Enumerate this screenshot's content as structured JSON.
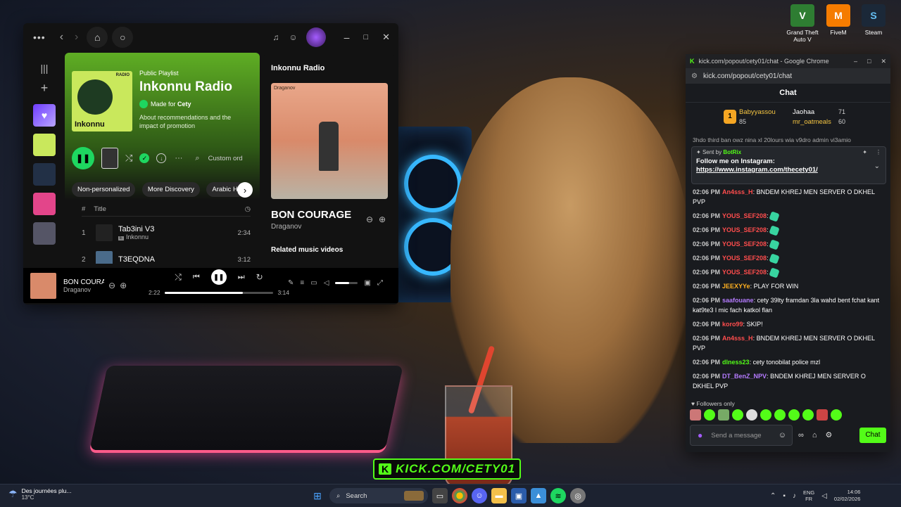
{
  "desktop": {
    "icons": [
      {
        "label": "Grand Theft Auto V",
        "color": "#2e7d32",
        "glyph": "V"
      },
      {
        "label": "FiveM",
        "color": "#f57c00",
        "glyph": "M"
      },
      {
        "label": "Steam",
        "color": "#1b2838",
        "glyph": "S"
      }
    ],
    "stream_overlay": "KICK.COM/CETY01",
    "overlay_logo": "K"
  },
  "spotify": {
    "playlist": {
      "type_label": "Public Playlist",
      "title": "Inkonnu Radio",
      "made_for_prefix": "Made for",
      "made_for_user": "Cety",
      "description": "About recommendations and the impact of promotion",
      "cover_text": "Inkonnu",
      "cover_tag": "RADIO"
    },
    "sort_label": "Custom ord",
    "filters": [
      "Non-personalized",
      "More Discovery",
      "Arabic Hi"
    ],
    "table": {
      "num_header": "#",
      "title_header": "Title"
    },
    "tracks": [
      {
        "num": "1",
        "title": "Tab3ini V3",
        "artist": "Inkonnu",
        "duration": "2:34"
      },
      {
        "num": "2",
        "title": "T3EQDNA",
        "artist": "",
        "duration": "3:12"
      }
    ],
    "now_panel": {
      "header": "Inkonnu Radio",
      "art_label": "Draganov",
      "title": "BON COURAGE",
      "artist": "Draganov",
      "related": "Related music videos"
    },
    "player": {
      "title": "BON COURAG",
      "artist": "Draganov",
      "elapsed": "2:22",
      "total": "3:14",
      "progress": 0.72,
      "volume": 0.6
    }
  },
  "chat": {
    "window_title": "kick.com/popout/cety01/chat - Google Chrome",
    "url": "kick.com/popout/cety01/chat",
    "header": "Chat",
    "leaderboard": [
      {
        "rank": "1",
        "name": "Babyyassou",
        "value": "85"
      },
      {
        "name": "Jaohaa",
        "value": "71"
      },
      {
        "name": "mr_oatmeals",
        "value": "60"
      }
    ],
    "clipped_text": "3hdo third ban owz nina xl 20lours wia v9dro admin vi3amio",
    "pinned": {
      "sent_by": "Sent by",
      "bot": "BotRix",
      "line1": "Follow me on Instagram:",
      "line2": "https://www.instagram.com/thecety01/"
    },
    "messages": [
      {
        "time": "02:06 PM",
        "user": "An4sss_H",
        "color": "#ff4d4d",
        "text": "BNDEM KHREJ MEN SERVER O DKHEL PVP"
      },
      {
        "time": "02:06 PM",
        "user": "YOUS_SEF208",
        "color": "#ff4d4d",
        "text": ""
      },
      {
        "time": "02:06 PM",
        "user": "YOUS_SEF208",
        "color": "#ff4d4d",
        "text": ""
      },
      {
        "time": "02:06 PM",
        "user": "YOUS_SEF208",
        "color": "#ff4d4d",
        "text": ""
      },
      {
        "time": "02:06 PM",
        "user": "YOUS_SEF208",
        "color": "#ff4d4d",
        "text": ""
      },
      {
        "time": "02:06 PM",
        "user": "YOUS_SEF208",
        "color": "#ff4d4d",
        "text": ""
      },
      {
        "time": "02:06 PM",
        "user": "JEEXYYe",
        "color": "#ffb020",
        "text": "PLAY FOR WIN"
      },
      {
        "time": "02:06 PM",
        "user": "saafouane",
        "color": "#b57bff",
        "text": "cety 39lty framdan 3la wahd bent fchat kant kat9te3 l mic fach katkol flan"
      },
      {
        "time": "02:06 PM",
        "user": "koro99",
        "color": "#ff4d4d",
        "text": "SKIP!"
      },
      {
        "time": "02:06 PM",
        "user": "An4sss_H",
        "color": "#ff4d4d",
        "text": "BNDEM KHREJ MEN SERVER O DKHEL PVP"
      },
      {
        "time": "02:06 PM",
        "user": "dlness23",
        "color": "#53fc18",
        "text": "cety tonobilat police mzl"
      },
      {
        "time": "02:06 PM",
        "user": "DT_BenZ_NPV",
        "color": "#b57bff",
        "text": "BNDEM KHREJ MEN SERVER O DKHEL PVP"
      }
    ],
    "followers_only": "Followers only",
    "input_placeholder": "Send a message",
    "send_label": "Chat",
    "accent": "#53fc18"
  },
  "taskbar": {
    "weather_text": "Des journées plu...",
    "temperature": "13°C",
    "search_label": "Search",
    "lang": "ENG",
    "region": "FR",
    "time": "14:06",
    "date": "02/02/2026"
  }
}
